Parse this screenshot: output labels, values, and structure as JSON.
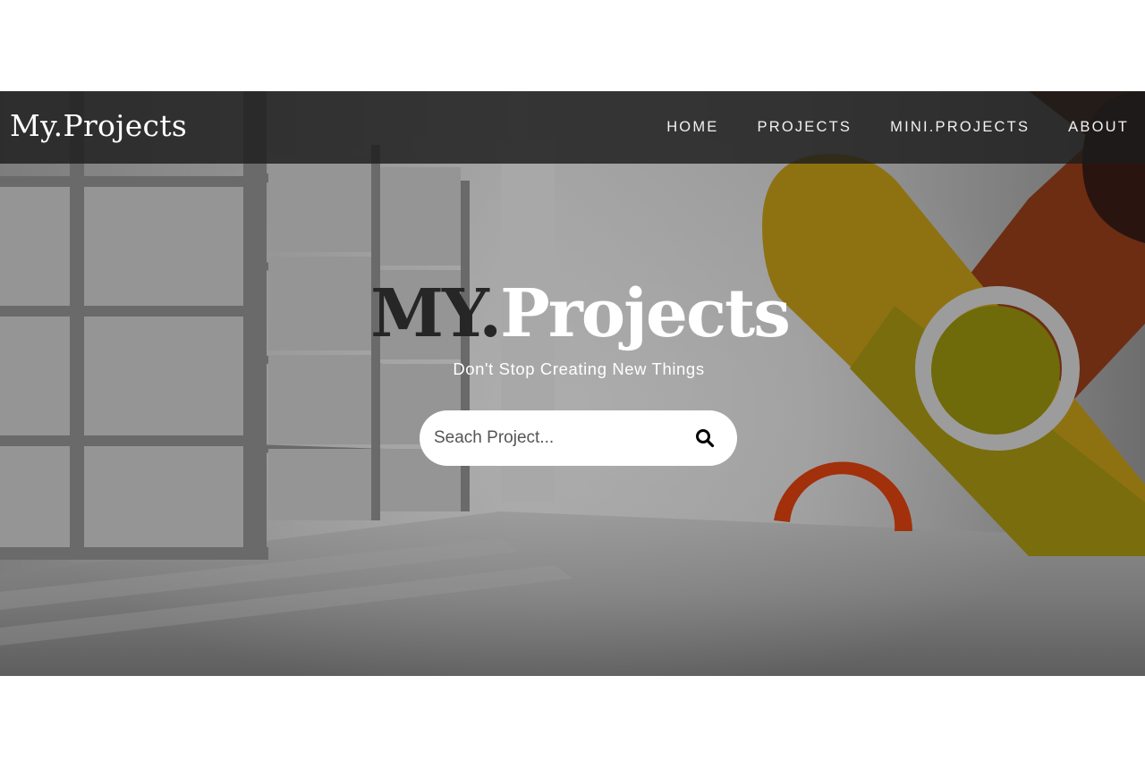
{
  "brand": {
    "name": "My.Projects"
  },
  "nav": {
    "items": [
      {
        "label": "HOME",
        "icon": null
      },
      {
        "label": "PROJECTS",
        "icon": null
      },
      {
        "label": "MINI.PROJECTS",
        "icon": null
      },
      {
        "label": "ABOUT",
        "icon": null
      }
    ]
  },
  "hero": {
    "title_part1": "MY.",
    "title_part2": "Projects",
    "tagline": "Don't Stop Creating New Things",
    "background": "interior-room-with-windows-and-abstract-wall-art"
  },
  "search": {
    "placeholder": "Seach Project...",
    "value": "",
    "icon": "search-icon"
  },
  "colors": {
    "navbar_bg": "#1c1c1c",
    "accent_yellow": "#c8a21c",
    "accent_red": "#b0300c",
    "title_dark": "#262626",
    "title_light": "#ffffff"
  }
}
